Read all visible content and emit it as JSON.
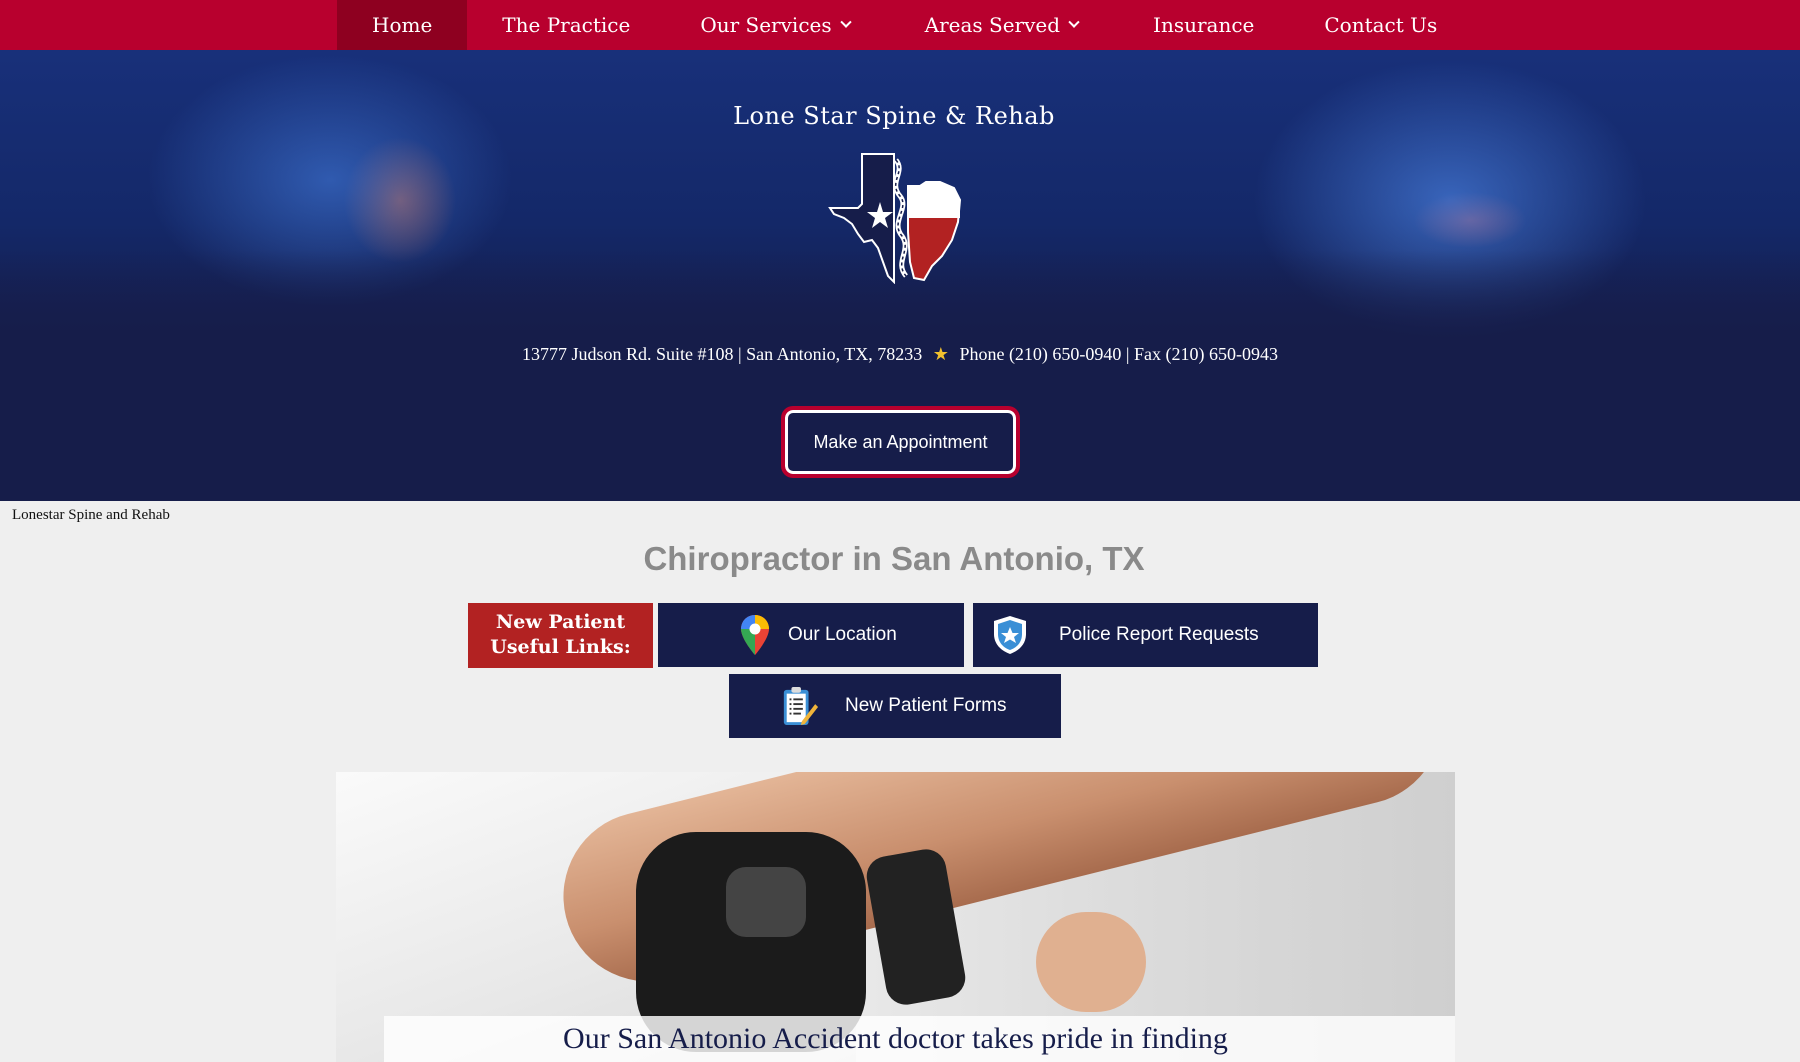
{
  "nav": {
    "items": [
      {
        "label": "Home",
        "active": true,
        "dropdown": false
      },
      {
        "label": "The Practice",
        "active": false,
        "dropdown": false
      },
      {
        "label": "Our Services",
        "active": false,
        "dropdown": true
      },
      {
        "label": "Areas Served",
        "active": false,
        "dropdown": true
      },
      {
        "label": "Insurance",
        "active": false,
        "dropdown": false
      },
      {
        "label": "Contact Us",
        "active": false,
        "dropdown": false
      }
    ]
  },
  "hero": {
    "brand": "Lone Star Spine & Rehab",
    "address": "13777 Judson Rd. Suite #108 | San Antonio, TX, 78233",
    "contact": "Phone (210) 650-0940 | Fax (210) 650-0943",
    "cta": "Make an Appointment"
  },
  "content": {
    "site_label": "Lonestar Spine and Rehab",
    "heading": "Chiropractor in San Antonio, TX",
    "new_patient_label_line1": "New Patient",
    "new_patient_label_line2": "Useful Links:",
    "links": {
      "location": "Our Location",
      "police": "Police Report Requests",
      "forms": "New Patient Forms"
    },
    "photo_caption": "Our San Antonio Accident doctor takes pride in finding"
  },
  "colors": {
    "nav_red": "#b8002e",
    "navy": "#161d4a",
    "label_red": "#b22222",
    "star_gold": "#f2c12e"
  },
  "icons": [
    "chevron-down-icon",
    "star-icon",
    "map-pin-icon",
    "police-badge-icon",
    "clipboard-icon"
  ]
}
